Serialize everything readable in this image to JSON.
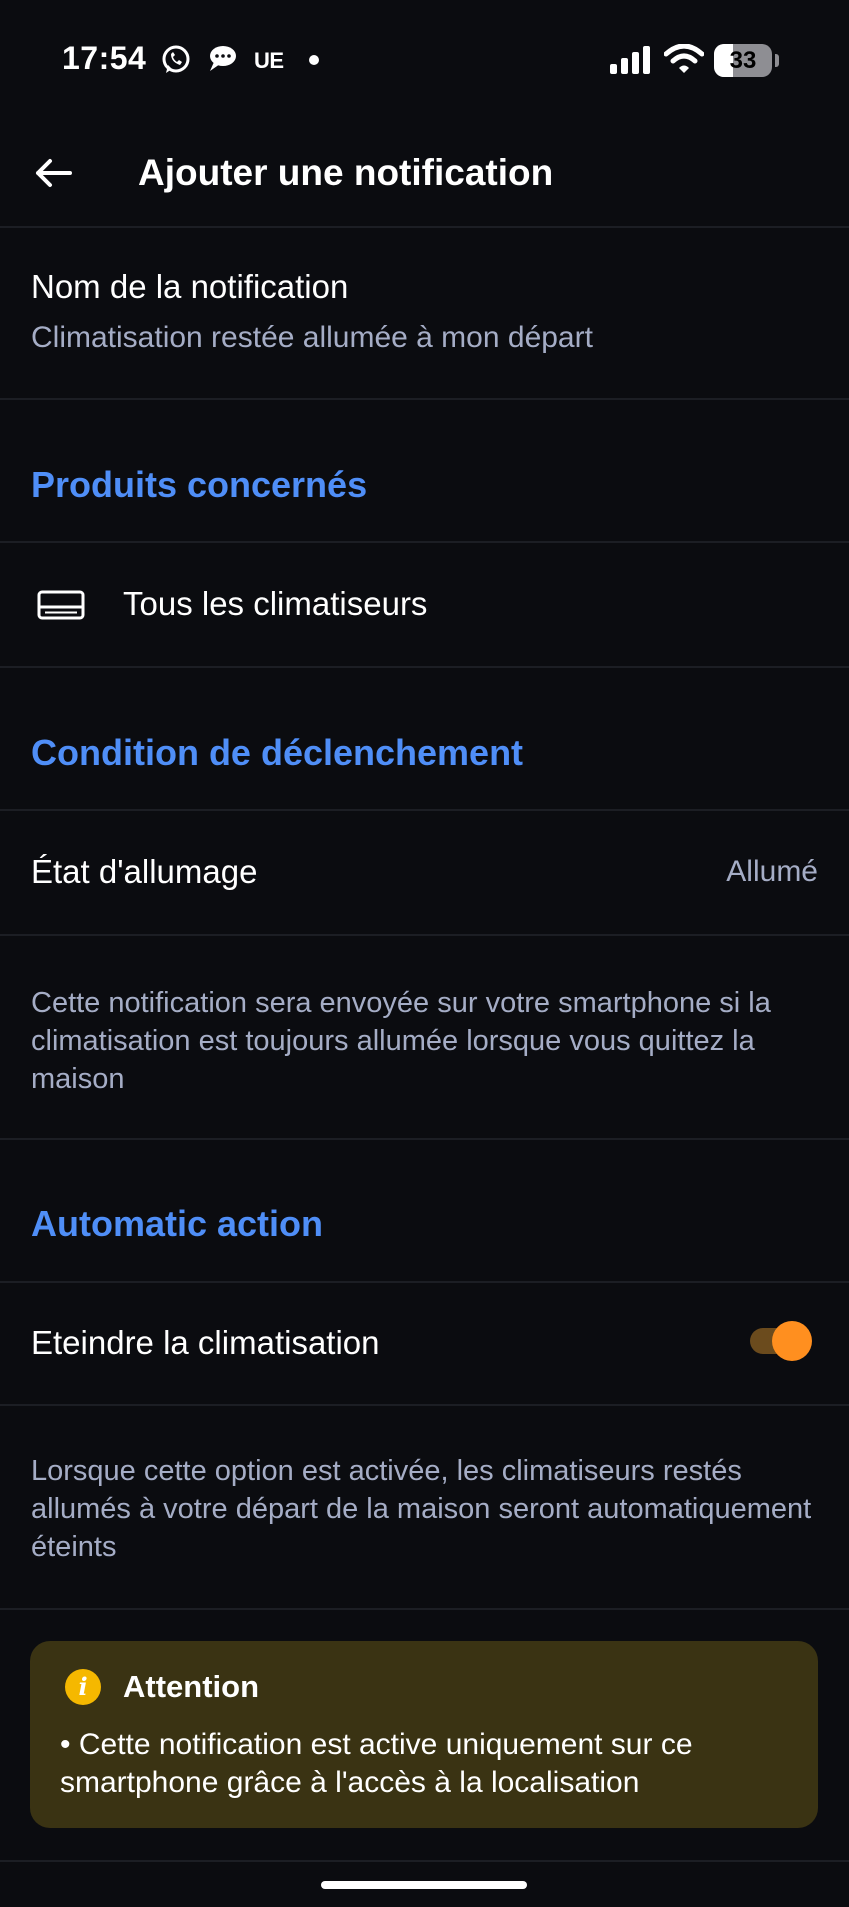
{
  "status_bar": {
    "time": "17:54",
    "carrier_badge": "UE",
    "battery_level": "33",
    "battery_fraction": 0.33,
    "icons": [
      "whatsapp-icon",
      "chat-bubble-icon",
      "signal-icon",
      "wifi-icon",
      "battery-icon"
    ]
  },
  "header": {
    "title": "Ajouter une notification",
    "back_icon": "arrow-left-icon"
  },
  "notification_name": {
    "label": "Nom de la notification",
    "value": "Climatisation restée allumée à mon départ"
  },
  "products_section": {
    "title": "Produits concernés",
    "item_label": "Tous les climatiseurs",
    "item_icon": "air-conditioner-icon"
  },
  "trigger_section": {
    "title": "Condition de déclenchement",
    "state_label": "État d'allumage",
    "state_value": "Allumé",
    "description": "Cette notification sera envoyée sur votre smartphone si la climatisation est toujours allumée lorsque vous quittez la maison"
  },
  "action_section": {
    "title": "Automatic action",
    "toggle_label": "Eteindre la climatisation",
    "toggle_on": true,
    "description": "Lorsque cette option est activée, les climatiseurs restés allumés à votre départ de la maison seront automatiquement éteints"
  },
  "attention": {
    "icon_glyph": "i",
    "title": "Attention",
    "text": "• Cette notification est active uniquement sur ce smartphone grâce à l'accès à la localisation"
  },
  "colors": {
    "background": "#0b0c10",
    "section_title": "#4f8ef7",
    "secondary_text": "#a5adc6",
    "toggle_accent": "#ff8f1f",
    "attention_bg": "#3a3313",
    "attention_icon": "#f5b800"
  }
}
